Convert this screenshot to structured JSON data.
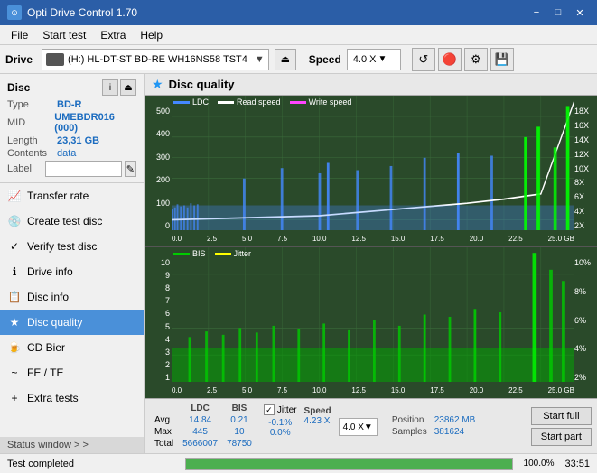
{
  "titleBar": {
    "title": "Opti Drive Control 1.70",
    "icon": "⊙",
    "minimizeBtn": "−",
    "maximizeBtn": "□",
    "closeBtn": "✕"
  },
  "menuBar": {
    "items": [
      "File",
      "Start test",
      "Extra",
      "Help"
    ]
  },
  "driveBar": {
    "label": "Drive",
    "driveText": "(H:)  HL-DT-ST BD-RE  WH16NS58 TST4",
    "speedLabel": "Speed",
    "speedValue": "4.0 X"
  },
  "disc": {
    "title": "Disc",
    "typeLabel": "Type",
    "typeValue": "BD-R",
    "midLabel": "MID",
    "midValue": "UMEBDR016 (000)",
    "lengthLabel": "Length",
    "lengthValue": "23,31 GB",
    "contentsLabel": "Contents",
    "contentsValue": "data",
    "labelLabel": "Label",
    "labelValue": ""
  },
  "navItems": [
    {
      "id": "transfer-rate",
      "label": "Transfer rate",
      "icon": "📈"
    },
    {
      "id": "create-test-disc",
      "label": "Create test disc",
      "icon": "💿"
    },
    {
      "id": "verify-test-disc",
      "label": "Verify test disc",
      "icon": "✓"
    },
    {
      "id": "drive-info",
      "label": "Drive info",
      "icon": "ℹ"
    },
    {
      "id": "disc-info",
      "label": "Disc info",
      "icon": "📋"
    },
    {
      "id": "disc-quality",
      "label": "Disc quality",
      "icon": "★",
      "active": true
    },
    {
      "id": "cd-bier",
      "label": "CD Bier",
      "icon": "🍺"
    },
    {
      "id": "fe-te",
      "label": "FE / TE",
      "icon": "~"
    },
    {
      "id": "extra-tests",
      "label": "Extra tests",
      "icon": "+"
    }
  ],
  "statusWindow": {
    "label": "Status window > >"
  },
  "qualityPanel": {
    "title": "Disc quality"
  },
  "topChart": {
    "legend": [
      {
        "label": "LDC",
        "color": "#4488ff"
      },
      {
        "label": "Read speed",
        "color": "#ffffff"
      },
      {
        "label": "Write speed",
        "color": "#ff44ff"
      }
    ],
    "yLabels": [
      "18X",
      "16X",
      "14X",
      "12X",
      "10X",
      "8X",
      "6X",
      "4X",
      "2X"
    ],
    "yLabelsLeft": [
      "500",
      "400",
      "300",
      "200",
      "100",
      "0"
    ],
    "xLabels": [
      "0.0",
      "2.5",
      "5.0",
      "7.5",
      "10.0",
      "12.5",
      "15.0",
      "17.5",
      "20.0",
      "22.5",
      "25.0 GB"
    ]
  },
  "bottomChart": {
    "legend": [
      {
        "label": "BIS",
        "color": "#00cc00"
      },
      {
        "label": "Jitter",
        "color": "#ffff00"
      }
    ],
    "yLabels": [
      "10%",
      "8%",
      "6%",
      "4%",
      "2%"
    ],
    "yLabelsLeft": [
      "10",
      "9",
      "8",
      "7",
      "6",
      "5",
      "4",
      "3",
      "2",
      "1"
    ],
    "xLabels": [
      "0.0",
      "2.5",
      "5.0",
      "7.5",
      "10.0",
      "12.5",
      "15.0",
      "17.5",
      "20.0",
      "22.5",
      "25.0 GB"
    ]
  },
  "stats": {
    "columns": [
      "",
      "LDC",
      "BIS",
      "",
      "Jitter",
      "Speed"
    ],
    "rows": [
      {
        "label": "Avg",
        "ldc": "14.84",
        "bis": "0.21",
        "jitter": "-0.1%",
        "speed": "4.23 X"
      },
      {
        "label": "Max",
        "ldc": "445",
        "bis": "10",
        "jitter": "0.0%",
        "speed": ""
      },
      {
        "label": "Total",
        "ldc": "5666007",
        "bis": "78750",
        "jitter": "",
        "speed": ""
      }
    ],
    "jitterCheckbox": "✓",
    "speedDisplay": "4.0 X",
    "position": {
      "label": "Position",
      "value": "23862 MB"
    },
    "samples": {
      "label": "Samples",
      "value": "381624"
    },
    "buttons": {
      "startFull": "Start full",
      "startPart": "Start part"
    }
  },
  "statusBar": {
    "text": "Test completed",
    "progressPercent": 100,
    "progressText": "100.0%",
    "time": "33:51"
  }
}
